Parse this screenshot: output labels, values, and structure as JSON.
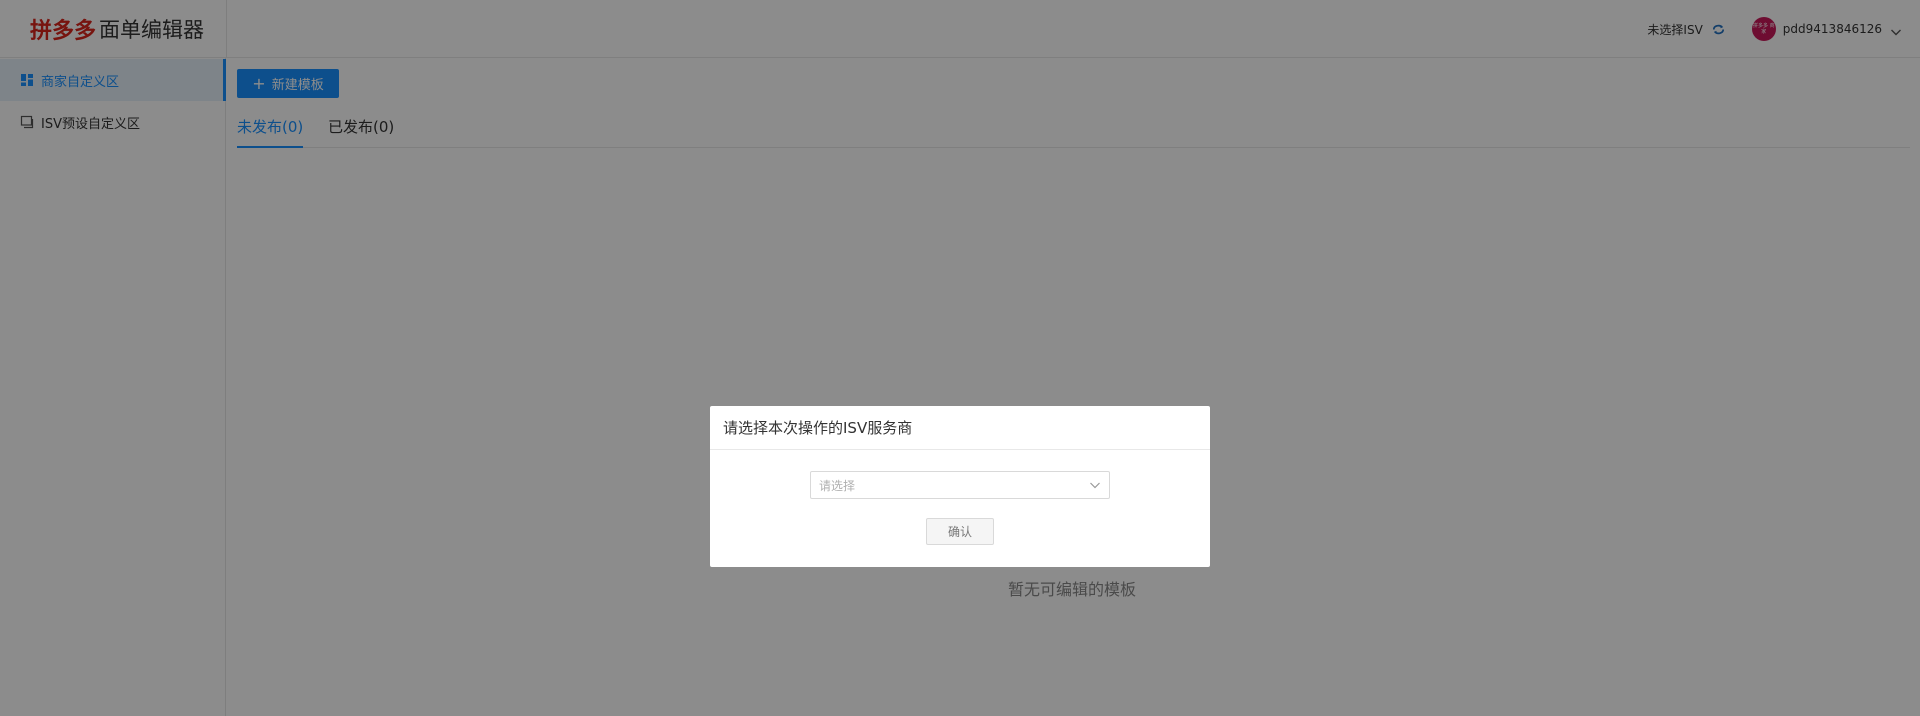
{
  "header": {
    "logo_brand": "拼多多",
    "logo_rest": "面单编辑器",
    "isv_status": "未选择ISV",
    "username": "pdd9413846126",
    "avatar_text": "拼多多 商家"
  },
  "sidebar": {
    "items": [
      {
        "label": "商家自定义区",
        "icon": "grid-icon",
        "active": true
      },
      {
        "label": "ISV预设自定义区",
        "icon": "window-icon",
        "active": false
      }
    ]
  },
  "main": {
    "new_template_label": "新建模板",
    "tabs": [
      {
        "label": "未发布(0)",
        "active": true
      },
      {
        "label": "已发布(0)",
        "active": false
      }
    ],
    "empty_text": "暂无可编辑的模板"
  },
  "modal": {
    "title": "请选择本次操作的ISV服务商",
    "select_placeholder": "请选择",
    "confirm_label": "确认"
  },
  "colors": {
    "brand_red": "#d9251c",
    "primary_blue": "#1890ff",
    "avatar": "#c8195a"
  }
}
